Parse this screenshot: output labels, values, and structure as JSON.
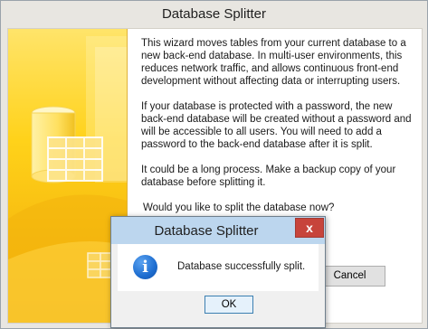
{
  "main_window": {
    "title": "Database Splitter",
    "paragraphs": [
      "This wizard moves tables from your current database to a new back-end database. In multi-user environments, this reduces network traffic, and allows continuous front-end development without affecting data or interrupting users.",
      "If your database is protected with a password, the new back-end database will be created without a password and will be accessible to all users. You will need to add a password to the back-end database after it is split.",
      "It could be a long process. Make a backup copy of your database before splitting it."
    ],
    "question": "Would you like to split the database now?",
    "cancel_label": "Cancel"
  },
  "dialog": {
    "title": "Database Splitter",
    "close_glyph": "x",
    "icon": "information-icon",
    "message": "Database successfully split.",
    "ok_label": "OK"
  }
}
